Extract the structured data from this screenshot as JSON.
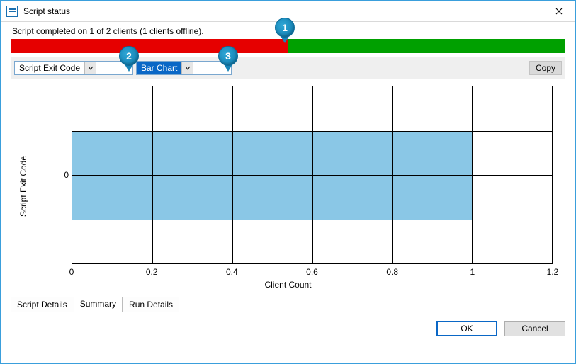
{
  "window": {
    "title": "Script status"
  },
  "status": {
    "text": "Script completed on 1 of 2 clients (1 clients offline)."
  },
  "progress": {
    "red_pct": 50
  },
  "callouts": {
    "c1": "1",
    "c2": "2",
    "c3": "3"
  },
  "toolbar": {
    "dd1_label": "Script Exit Code",
    "dd2_label": "Bar Chart",
    "copy_label": "Copy"
  },
  "chart": {
    "ylabel": "Script Exit Code",
    "xlabel": "Client Count",
    "ytick_0": "0",
    "xt_0": "0",
    "xt_02": "0.2",
    "xt_04": "0.4",
    "xt_06": "0.6",
    "xt_08": "0.8",
    "xt_1": "1",
    "xt_12": "1.2"
  },
  "chart_data": {
    "type": "bar",
    "orientation": "horizontal",
    "title": "",
    "xlabel": "Client Count",
    "ylabel": "Script Exit Code",
    "xlim": [
      0,
      1.2
    ],
    "categories": [
      "0"
    ],
    "values": [
      1
    ],
    "grid": true
  },
  "tabs": {
    "t1": "Script Details",
    "t2": "Summary",
    "t3": "Run Details",
    "active": "t2"
  },
  "buttons": {
    "ok": "OK",
    "cancel": "Cancel"
  }
}
